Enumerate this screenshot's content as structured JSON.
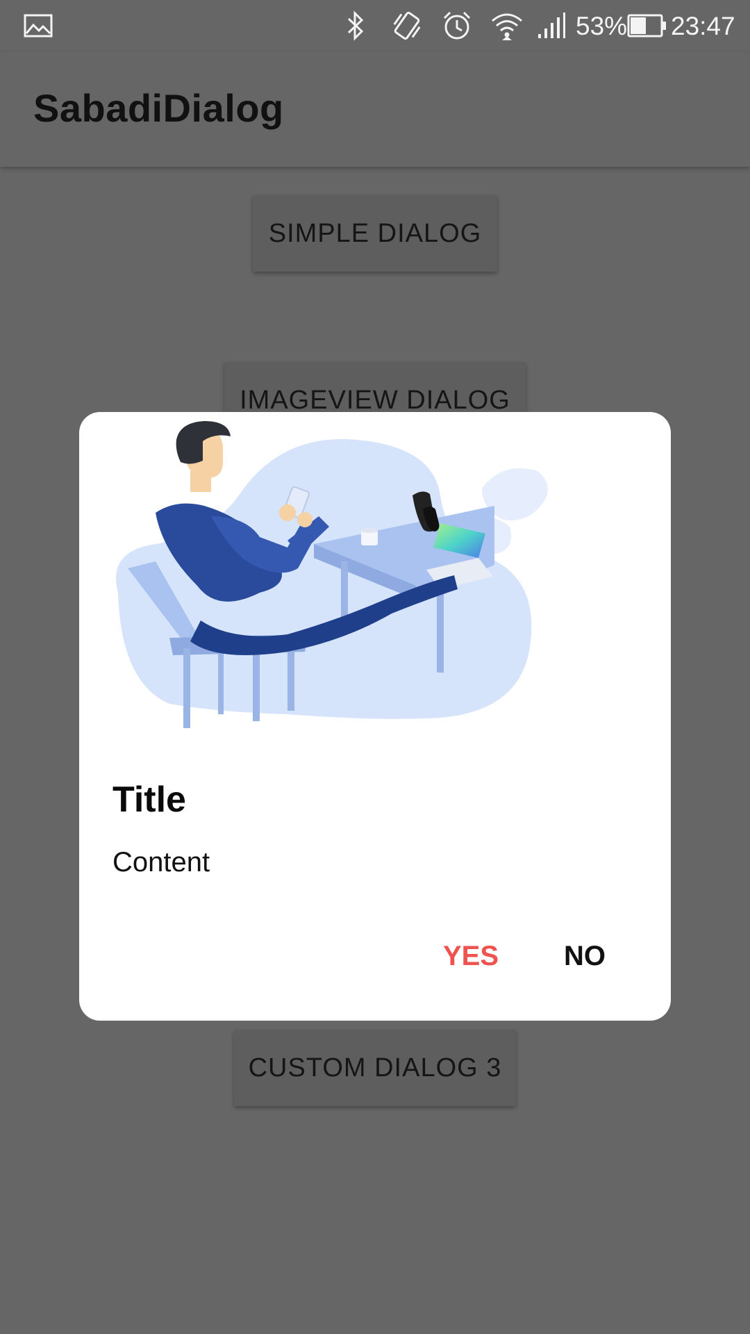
{
  "status_bar": {
    "battery_percent": "53%",
    "time": "23:47",
    "icons": [
      "gallery-icon",
      "bluetooth-icon",
      "vibrate-icon",
      "alarm-icon",
      "wifi-icon",
      "signal-icon",
      "battery-icon"
    ]
  },
  "app_bar": {
    "title": "SabadiDialog"
  },
  "buttons": {
    "simple_dialog": "SIMPLE DIALOG",
    "imageview_dialog": "IMAGEVIEW DIALOG",
    "custom_dialog_3": "CUSTOM DIALOG 3"
  },
  "dialog": {
    "title": "Title",
    "content": "Content",
    "yes_label": "YES",
    "no_label": "NO"
  },
  "colors": {
    "scrim_background": "#666666",
    "dialog_background": "#ffffff",
    "yes_accent": "#ef5350",
    "illustration_blob": "#d6e4fb",
    "illustration_navy": "#2a4a9c"
  }
}
